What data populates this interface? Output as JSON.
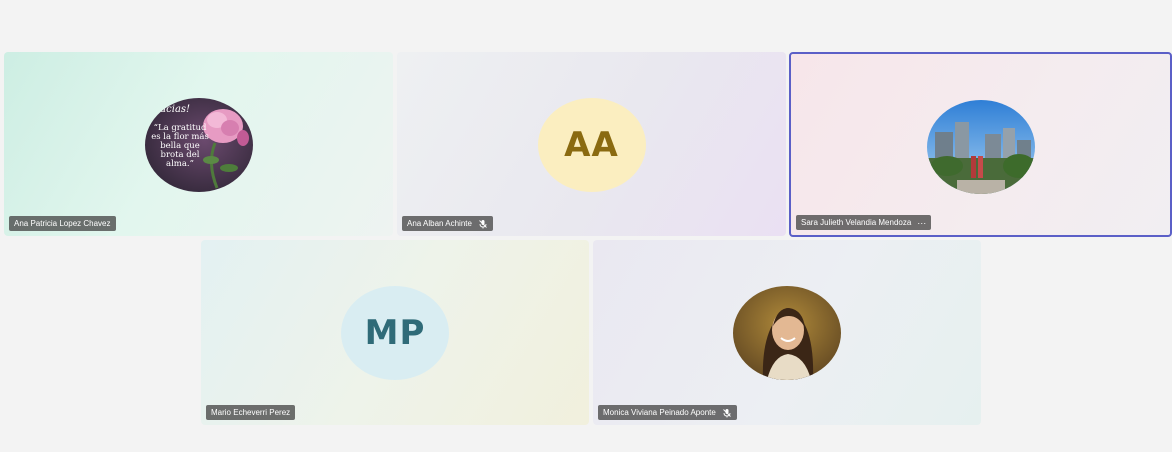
{
  "participants": [
    {
      "name": "Ana Patricia Lopez Chavez",
      "avatar_type": "photo",
      "photo_label": "flower-quote-image",
      "photo_quote_header": "gracias!",
      "photo_quote": "“La gratitud es la flor más bella que brota del alma.”",
      "muted": false,
      "active": false
    },
    {
      "name": "Ana Alban Achinte",
      "avatar_type": "initials",
      "initials": "AA",
      "muted": true,
      "active": false
    },
    {
      "name": "Sara Julieth Velandia Mendoza",
      "avatar_type": "photo",
      "photo_label": "city-skyline-photo",
      "muted": false,
      "active": true,
      "more_glyph": "···"
    },
    {
      "name": "Mario Echeverri Perez",
      "avatar_type": "initials",
      "initials": "MP",
      "muted": false,
      "active": false
    },
    {
      "name": "Monica Viviana Peinado Aponte",
      "avatar_type": "photo",
      "photo_label": "woman-portrait-photo",
      "muted": true,
      "active": false
    }
  ],
  "icons": {
    "mute": "mic-off-icon",
    "more": "more-options-icon"
  },
  "colors": {
    "active_border": "#5b5fc7",
    "nametag_bg": "#484848",
    "aa_avatar_bg": "#fbeec0",
    "aa_avatar_text": "#8a6a10",
    "mp_avatar_bg": "#d9edf2",
    "mp_avatar_text": "#2f6b78"
  }
}
